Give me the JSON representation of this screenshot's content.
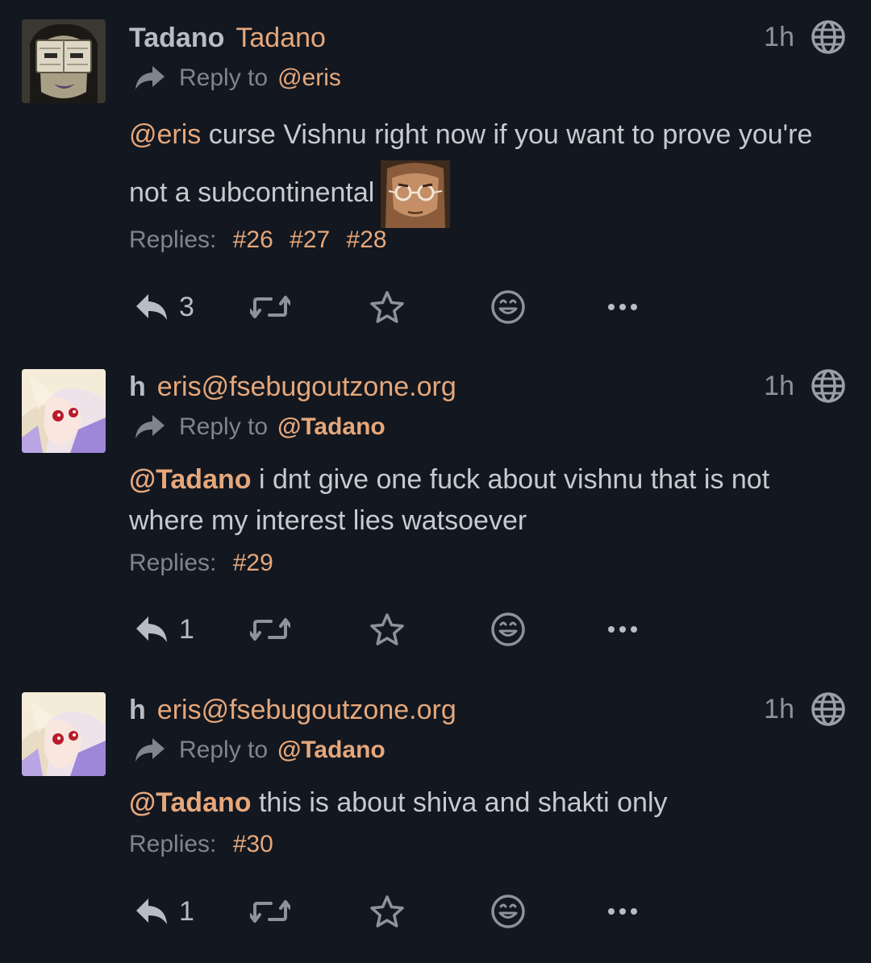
{
  "posts": [
    {
      "display_name": "Tadano",
      "account": "Tadano",
      "time": "1h",
      "reply_prefix": "Reply to",
      "reply_mention": "@eris",
      "content_mention": "@eris",
      "content_text": " curse Vishnu right now if you want to prove you're not a subcontinental",
      "replies_label": "Replies:",
      "reply_links": [
        "#26",
        "#27",
        "#28"
      ],
      "reply_count": "3"
    },
    {
      "display_name": "h",
      "account": "eris@fsebugoutzone.org",
      "time": "1h",
      "reply_prefix": "Reply to",
      "reply_mention": "@Tadano",
      "content_mention": "@Tadano",
      "content_text": " i dnt give one fuck about vishnu that is not where my interest lies watsoever",
      "replies_label": "Replies:",
      "reply_links": [
        "#29"
      ],
      "reply_count": "1"
    },
    {
      "display_name": "h",
      "account": "eris@fsebugoutzone.org",
      "time": "1h",
      "reply_prefix": "Reply to",
      "reply_mention": "@Tadano",
      "content_mention": "@Tadano",
      "content_text": " this is about shiva and shakti only",
      "replies_label": "Replies:",
      "reply_links": [
        "#30"
      ],
      "reply_count": "1"
    }
  ],
  "icons": {
    "reply": "reply-icon",
    "repeat": "repeat-icon",
    "favorite": "star-icon",
    "react": "emoji-react-icon",
    "more": "more-icon",
    "scope": "globe-icon",
    "reply_arrow": "share-arrow-icon"
  },
  "colors": {
    "background": "#121720",
    "link": "#e6a77a",
    "text": "#c7cacf",
    "muted": "#80858d"
  }
}
